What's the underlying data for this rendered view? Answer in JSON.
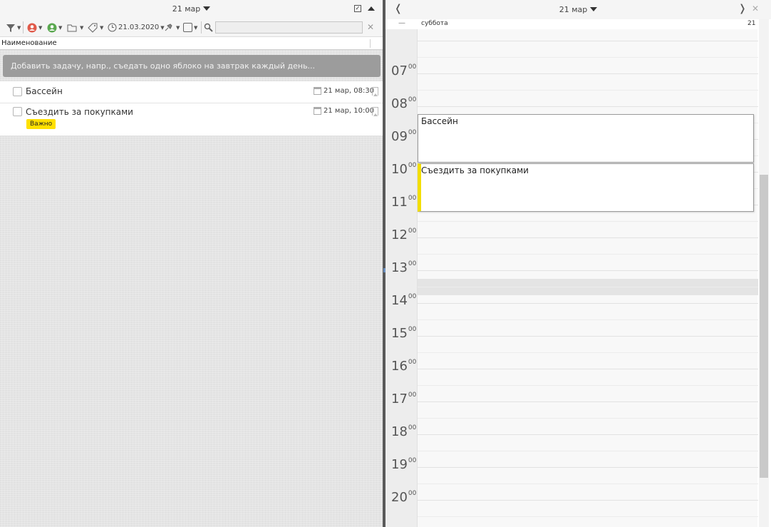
{
  "left_pane": {
    "header_date": "21 мар",
    "toolbar": {
      "date_filter": "21.03.2020",
      "search_value": ""
    },
    "column_header": "Наименование",
    "add_task_placeholder": "Добавить задачу, напр., съедать одно яблоко на завтрак каждый день...",
    "tasks": [
      {
        "title": "Бассейн",
        "date": "21 мар, 08:30",
        "tag": ""
      },
      {
        "title": "Съездить за покупками",
        "date": "21 мар, 10:00",
        "tag": "Важно"
      }
    ]
  },
  "calendar": {
    "header_date": "21 мар",
    "day_name": "суббота",
    "day_number": "21",
    "hours": [
      "07",
      "08",
      "09",
      "10",
      "11",
      "12",
      "13",
      "14",
      "15",
      "16",
      "17",
      "18",
      "19",
      "20"
    ],
    "minutes_label": "00",
    "events": [
      {
        "title": "Бассейн",
        "important": false
      },
      {
        "title": "Съездить за покупками",
        "important": true
      }
    ]
  },
  "colors": {
    "important_tag": "#ffe000",
    "add_task_bg": "#9c9c9c"
  }
}
